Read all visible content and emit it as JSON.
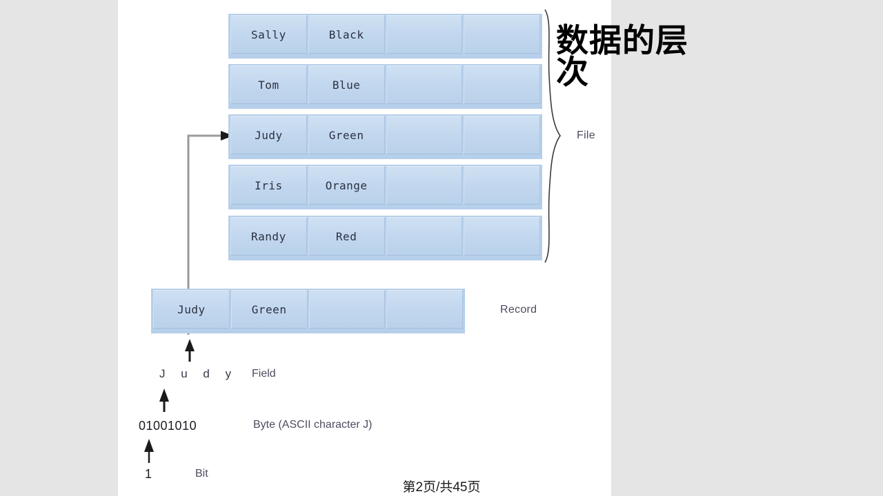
{
  "title": "数据的层次",
  "footer": "第2页/共45页",
  "file": {
    "label": "File",
    "rows": [
      {
        "cells": [
          "Sally",
          "Black",
          "",
          ""
        ]
      },
      {
        "cells": [
          "Tom",
          "Blue",
          "",
          ""
        ]
      },
      {
        "cells": [
          "Judy",
          "Green",
          "",
          ""
        ]
      },
      {
        "cells": [
          "Iris",
          "Orange",
          "",
          ""
        ]
      },
      {
        "cells": [
          "Randy",
          "Red",
          "",
          ""
        ]
      }
    ]
  },
  "record": {
    "label": "Record",
    "cells": [
      "Judy",
      "Green",
      "",
      ""
    ]
  },
  "hierarchy": {
    "field_value": "J u d y",
    "field_label": "Field",
    "byte_value": "01001010",
    "byte_label": "Byte (ASCII character J)",
    "bit_value": "1",
    "bit_label": "Bit"
  },
  "colors": {
    "background": "#e5e5e5",
    "slide": "#ffffff",
    "cell_fill": "#c3d8ef",
    "strip_fill": "#b6cfea",
    "label_text": "#4e4a5e",
    "title_text": "#000000",
    "connector": "#8d8d8d",
    "arrow": "#1a1a1a"
  }
}
